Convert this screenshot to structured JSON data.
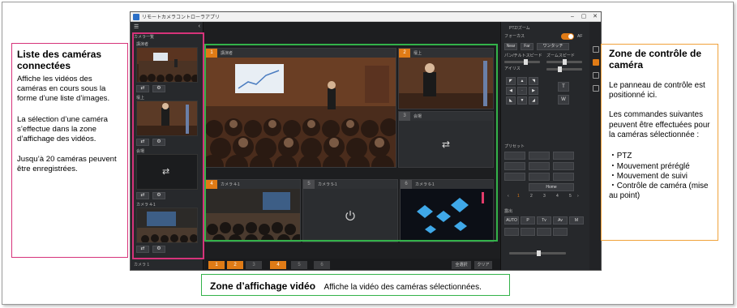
{
  "app": {
    "window_title": "リモートカメラコントローラアプリ",
    "camera_list_title": "カメラ一覧",
    "cameras": [
      {
        "name": "講演者"
      },
      {
        "name": "壇上"
      },
      {
        "name": "会場"
      },
      {
        "name": "カメラ 4-1"
      }
    ],
    "footer_label": "カメラ 1",
    "video_tiles": [
      {
        "num": "1",
        "name": "講演者"
      },
      {
        "num": "2",
        "name": "壇上"
      },
      {
        "num": "3",
        "name": "会場"
      },
      {
        "num": "4",
        "name": "カメラ 4-1"
      },
      {
        "num": "5",
        "name": "カメラ 5-1"
      },
      {
        "num": "6",
        "name": "カメラ 6-1"
      }
    ],
    "bottom_buttons": [
      "1",
      "2",
      "3",
      "4",
      "5",
      "6"
    ],
    "bottom_actions": {
      "multi_select": "全選択",
      "clear": "クリア"
    },
    "control": {
      "panel_title": "PTZ/ズーム",
      "focus_label": "フォーカス",
      "af_label": "AF",
      "near_label": "Near",
      "far_label": "Far",
      "one_touch_label": "ワンタッチ",
      "pan_tilt_speed_label": "パン/チルトスピード",
      "zoom_speed_label": "ズームスピード",
      "iris_label": "アイリス",
      "zoom_t": "T",
      "zoom_w": "W",
      "preset_label": "プリセット",
      "home_label": "Home",
      "preset_numbers": [
        "1",
        "2",
        "3",
        "4",
        "5"
      ],
      "exposure_label": "露出",
      "exposure_buttons": [
        "AUTO",
        "P",
        "Tv",
        "Av",
        "M"
      ]
    }
  },
  "callouts": {
    "left": {
      "title": "Liste des caméras connectées",
      "p1": "Affiche les vidéos des caméras en cours sous la forme d’une liste d’images.",
      "p2": "La sélection d’une caméra s’effectue dans la zone d’affichage des vidéos.",
      "p3": "Jusqu’à 20 caméras peuvent être enregistrées."
    },
    "right": {
      "title": "Zone de contrôle de caméra",
      "p1": "Le panneau de contrôle est positionné ici.",
      "p2": "Les commandes suivantes peuvent être effectuées pour la caméras sélectionnée :",
      "items": [
        "・PTZ",
        "・Mouvement préréglé",
        "・Mouvement de suivi",
        "・Contrôle de caméra (mise au point)"
      ]
    },
    "bottom": {
      "title": "Zone d’affichage vidéo",
      "desc": "Affiche la vidéo des caméras sélectionnées."
    }
  },
  "colors": {
    "accent": "#e07b16",
    "pink": "#d6337a",
    "green": "#33b24a",
    "orange": "#f0a23a"
  }
}
